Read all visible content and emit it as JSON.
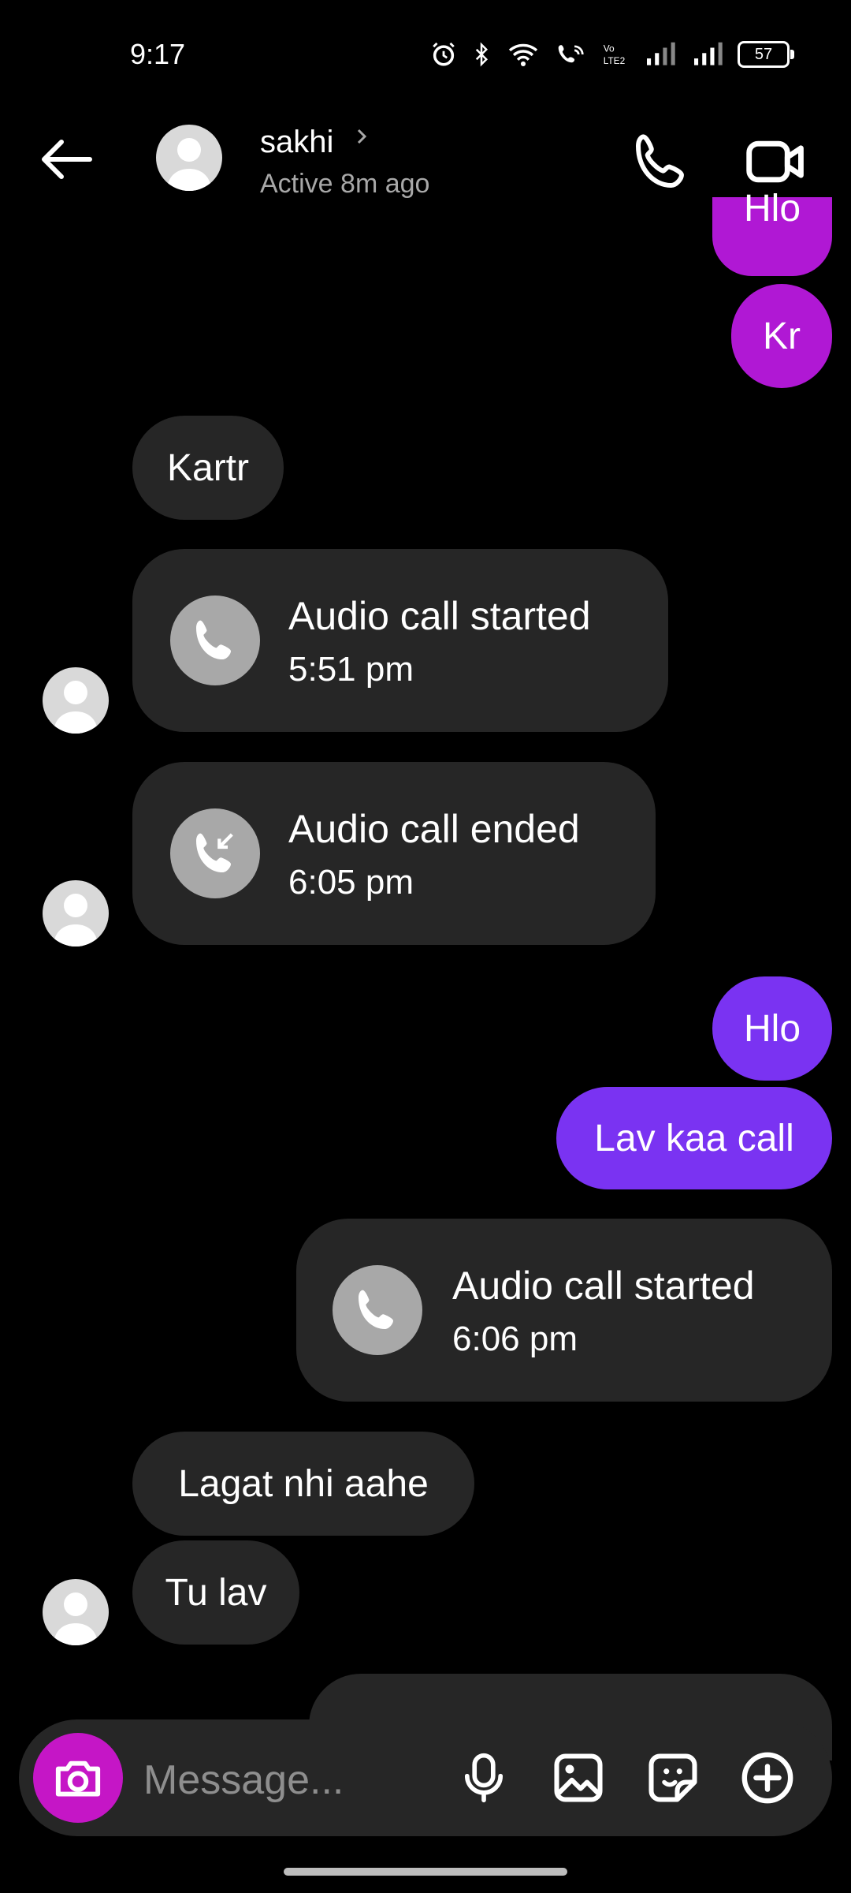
{
  "status_bar": {
    "time": "9:17",
    "battery": "57"
  },
  "header": {
    "name": "sakhi",
    "status": "Active 8m ago"
  },
  "messages": {
    "m0": "Hlo",
    "m1": "Kr",
    "m2": "Kartr",
    "call1": {
      "title": "Audio call started",
      "time": "5:51 pm"
    },
    "call2": {
      "title": "Audio call ended",
      "time": "6:05 pm"
    },
    "m3": "Hlo",
    "m4": "Lav kaa call",
    "call3": {
      "title": "Audio call started",
      "time": "6:06 pm"
    },
    "m5": "Lagat nhi aahe",
    "m6": "Tu lav"
  },
  "composer": {
    "placeholder": "Message..."
  },
  "colors": {
    "mine": "#b018d4",
    "mine_purple": "#7a33f2",
    "theirs": "#262626",
    "camera": "#c516c6"
  }
}
